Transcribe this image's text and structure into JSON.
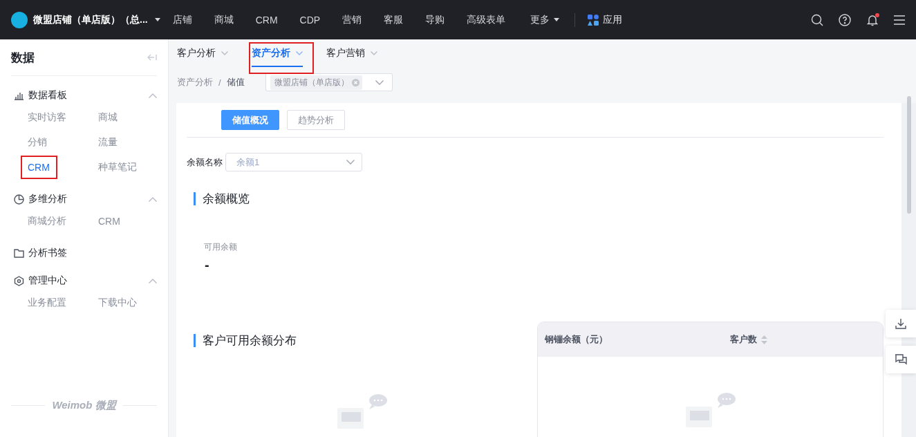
{
  "topbar": {
    "store": "微盟店铺（单店版）（总...",
    "nav": [
      "店铺",
      "商城",
      "CRM",
      "CDP",
      "营销",
      "客服",
      "导购",
      "高级表单"
    ],
    "more": "更多",
    "apps": "应用",
    "notification_dot": true
  },
  "sidebar": {
    "title": "数据",
    "groups": [
      {
        "kind": "group",
        "label": "数据看板",
        "expanded": true,
        "items": [
          {
            "label": "实时访客",
            "selected": false,
            "highlighted": false
          },
          {
            "label": "商城",
            "selected": false,
            "highlighted": false
          },
          {
            "label": "分销",
            "selected": false,
            "highlighted": false
          },
          {
            "label": "流量",
            "selected": false,
            "highlighted": false
          },
          {
            "label": "CRM",
            "selected": true,
            "highlighted": true
          },
          {
            "label": "种草笔记",
            "selected": false,
            "highlighted": false
          }
        ]
      },
      {
        "kind": "group",
        "label": "多维分析",
        "expanded": true,
        "items": [
          {
            "label": "商城分析",
            "selected": false,
            "highlighted": false
          },
          {
            "label": "CRM",
            "selected": false,
            "highlighted": false
          }
        ]
      },
      {
        "kind": "link",
        "label": "分析书签"
      },
      {
        "kind": "group",
        "label": "管理中心",
        "expanded": true,
        "items": [
          {
            "label": "业务配置",
            "selected": false,
            "highlighted": false
          },
          {
            "label": "下载中心",
            "selected": false,
            "highlighted": false
          }
        ]
      }
    ],
    "footer": "Weimob 微盟"
  },
  "subtabs": [
    {
      "label": "客户分析",
      "selected": false,
      "highlighted": false
    },
    {
      "label": "资产分析",
      "selected": true,
      "highlighted": true
    },
    {
      "label": "客户营销",
      "selected": false,
      "highlighted": false
    }
  ],
  "breadcrumb": {
    "items": [
      "资产分析",
      "储值"
    ],
    "separator": "/"
  },
  "store_select": {
    "tag": "微盟店铺（单店版）"
  },
  "segments": [
    {
      "label": "储值概况",
      "selected": true
    },
    {
      "label": "趋势分析",
      "selected": false
    }
  ],
  "filter": {
    "label": "余额名称",
    "value": "余额1"
  },
  "overview": {
    "title": "余额概览",
    "metric_label": "可用余额",
    "metric_value": "-"
  },
  "distribution": {
    "title": "客户可用余额分布",
    "table": {
      "columns": [
        {
          "label": "钢镚余额（元）",
          "sortable": false
        },
        {
          "label": "客户数",
          "sortable": true
        }
      ]
    }
  }
}
